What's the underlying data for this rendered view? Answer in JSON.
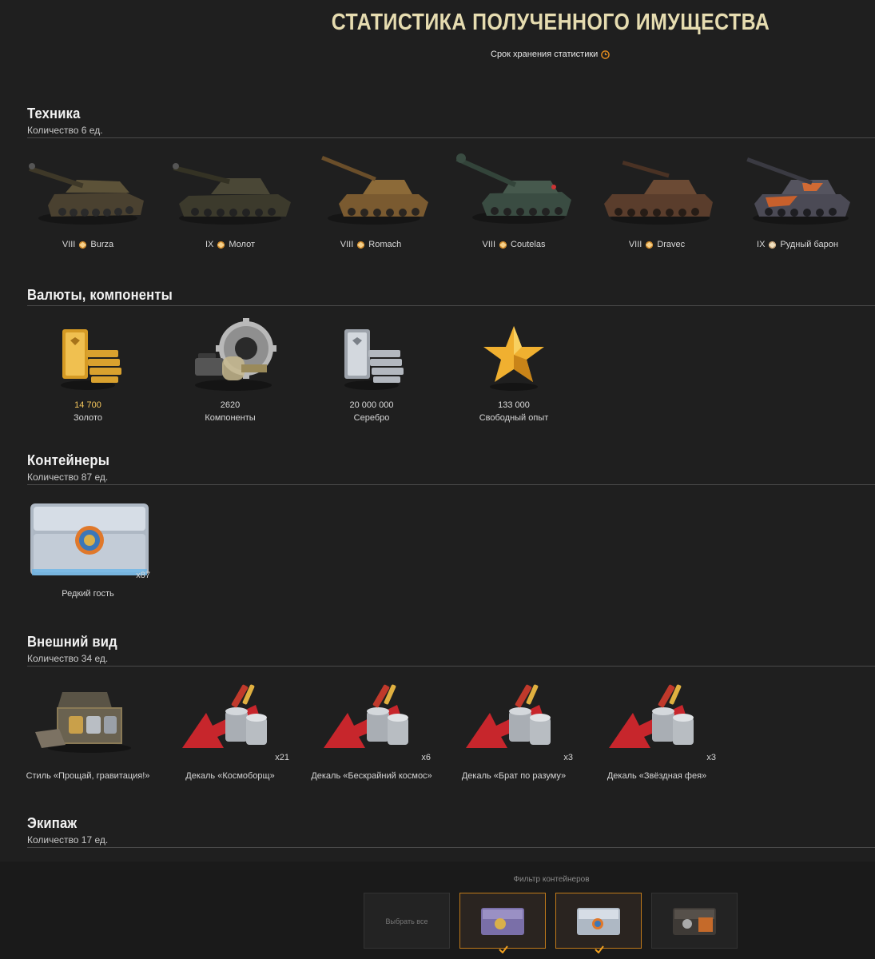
{
  "header": {
    "title": "СТАТИСТИКА ПОЛУЧЕННОГО ИМУЩЕСТВА",
    "subtitle": "Срок хранения статистики"
  },
  "vehicles": {
    "title": "Техника",
    "count": "Количество 6 ед.",
    "items": [
      {
        "tier": "VIII",
        "name": "Burza"
      },
      {
        "tier": "IX",
        "name": "Молот"
      },
      {
        "tier": "VIII",
        "name": "Romach"
      },
      {
        "tier": "VIII",
        "name": "Coutelas"
      },
      {
        "tier": "VIII",
        "name": "Dravec"
      },
      {
        "tier": "IX",
        "name": "Рудный барон"
      }
    ]
  },
  "currencies": {
    "title": "Валюты, компоненты",
    "items": [
      {
        "amount": "14 700",
        "label": "Золото",
        "icon": "gold-icon"
      },
      {
        "amount": "2620",
        "label": "Компоненты",
        "icon": "components-icon"
      },
      {
        "amount": "20 000 000",
        "label": "Серебро",
        "icon": "silver-icon"
      },
      {
        "amount": "133 000",
        "label": "Свободный опыт",
        "icon": "free-xp-star-icon"
      }
    ]
  },
  "containers": {
    "title": "Контейнеры",
    "count": "Количество 87 ед.",
    "items": [
      {
        "label": "Редкий гость",
        "mult": "x87"
      }
    ]
  },
  "customization": {
    "title": "Внешний вид",
    "count": "Количество 34 ед.",
    "items": [
      {
        "label": "Стиль «Прощай, гравитация!»",
        "mult": ""
      },
      {
        "label": "Декаль «Космоборщ»",
        "mult": "x21"
      },
      {
        "label": "Декаль «Бескрайний космос»",
        "mult": "x6"
      },
      {
        "label": "Декаль «Брат по разуму»",
        "mult": "x3"
      },
      {
        "label": "Декаль «Звёздная фея»",
        "mult": "x3"
      }
    ]
  },
  "crew": {
    "title": "Экипаж",
    "count": "Количество 17 ед."
  },
  "filter": {
    "title": "Фильтр контейнеров",
    "select_all": "Выбрать все"
  },
  "colors": {
    "gold": "#f3c55c",
    "title": "#e6dcb0",
    "accent_border": "#c07a1a"
  }
}
